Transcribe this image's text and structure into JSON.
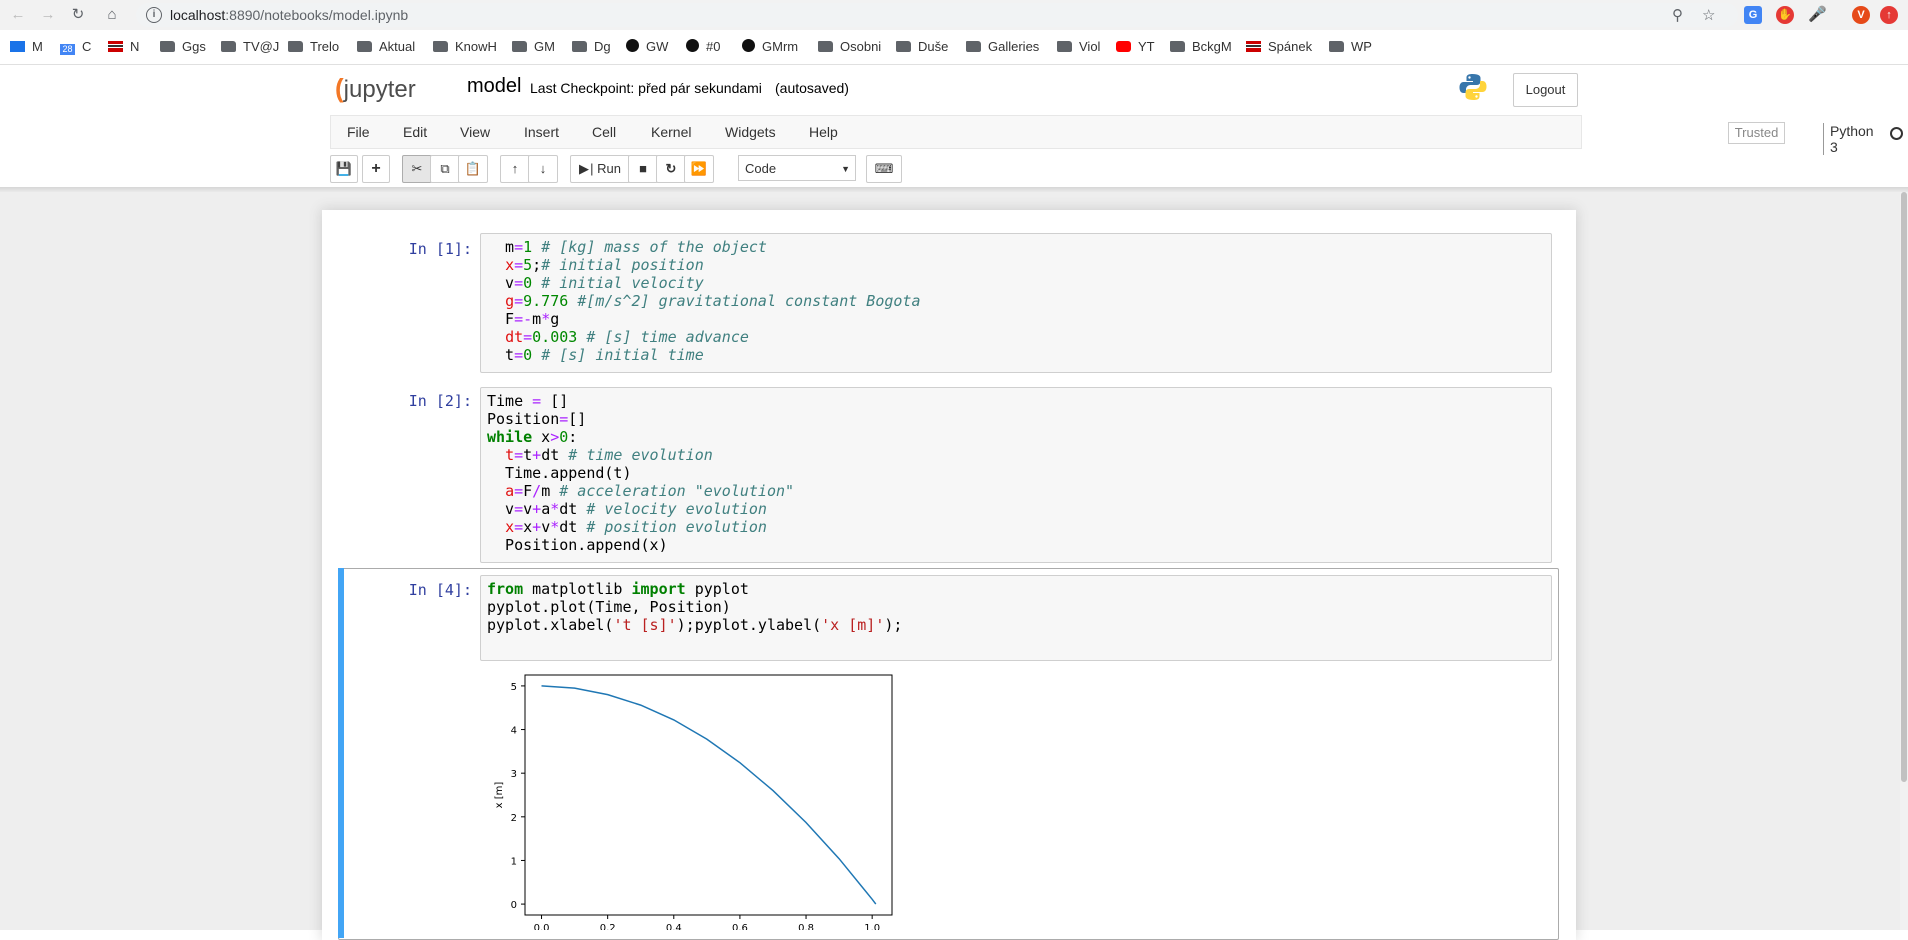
{
  "browser": {
    "url_host": "localhost",
    "url_rest": ":8890/notebooks/model.ipynb",
    "bookmarks": [
      "M",
      "C",
      "N",
      "Ggs",
      "TV@J",
      "Trelo",
      "Aktual",
      "KnowH",
      "GM",
      "Dg",
      "GW",
      "#0",
      "GMrm",
      "Osobni",
      "Duše",
      "Galleries",
      "Viol",
      "YT",
      "BckgM",
      "Spánek",
      "WP"
    ],
    "calendar_day": "28",
    "profile_initial": "V"
  },
  "jupyter": {
    "logo_text": "jupyter",
    "notebook_name": "model",
    "checkpoint": "Last Checkpoint: před pár sekundami",
    "autosaved": "(autosaved)",
    "logout": "Logout",
    "menus": [
      "File",
      "Edit",
      "View",
      "Insert",
      "Cell",
      "Kernel",
      "Widgets",
      "Help"
    ],
    "trusted": "Trusted",
    "kernel": "Python 3",
    "toolbar": {
      "run_label": "Run",
      "cell_type": "Code"
    }
  },
  "cells": [
    {
      "prompt": "In [1]:"
    },
    {
      "prompt": "In [2]:"
    },
    {
      "prompt": "In [4]:"
    }
  ],
  "chart_data": {
    "type": "line",
    "title": "",
    "xlabel": "",
    "ylabel": "x [m]",
    "xlim": [
      -0.05,
      1.06
    ],
    "ylim": [
      -0.25,
      5.25
    ],
    "xticks": [
      "0.0",
      "0.2",
      "0.4",
      "0.6",
      "0.8",
      "1.0"
    ],
    "yticks": [
      "0",
      "1",
      "2",
      "3",
      "4",
      "5"
    ],
    "color": "#1f77b4",
    "series": [
      {
        "x": [
          0.0,
          0.1,
          0.2,
          0.3,
          0.4,
          0.5,
          0.6,
          0.7,
          0.8,
          0.9,
          1.0,
          1.011
        ],
        "values": [
          5.0,
          4.95,
          4.8,
          4.56,
          4.22,
          3.78,
          3.24,
          2.6,
          1.87,
          1.04,
          0.11,
          0.0
        ]
      }
    ]
  }
}
